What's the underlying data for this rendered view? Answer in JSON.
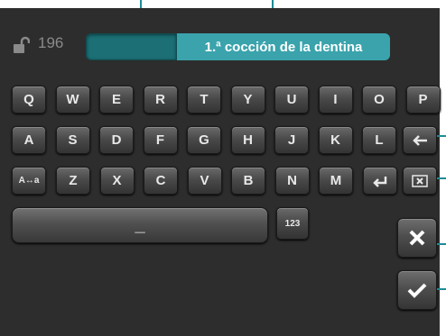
{
  "header": {
    "counter": "196",
    "title": "1.ª cocción de la dentina"
  },
  "keyboard": {
    "row1": [
      "Q",
      "W",
      "E",
      "R",
      "T",
      "Y",
      "U",
      "I",
      "O",
      "P"
    ],
    "row2": [
      "A",
      "S",
      "D",
      "F",
      "G",
      "H",
      "J",
      "K",
      "L"
    ],
    "row3_toggle": "A↔a",
    "row3": [
      "Z",
      "X",
      "C",
      "V",
      "B",
      "N",
      "M"
    ],
    "space_label": "_",
    "numeric_label": "123"
  },
  "colors": {
    "accent": "#3aa3ac",
    "callout": "#1e8c96",
    "background": "#2d2d2d"
  },
  "icons": {
    "lock": "unlock-icon",
    "backspace": "arrow-left-icon",
    "enter": "enter-icon",
    "clear": "clear-box-icon",
    "cancel": "x-icon",
    "confirm": "check-icon"
  }
}
